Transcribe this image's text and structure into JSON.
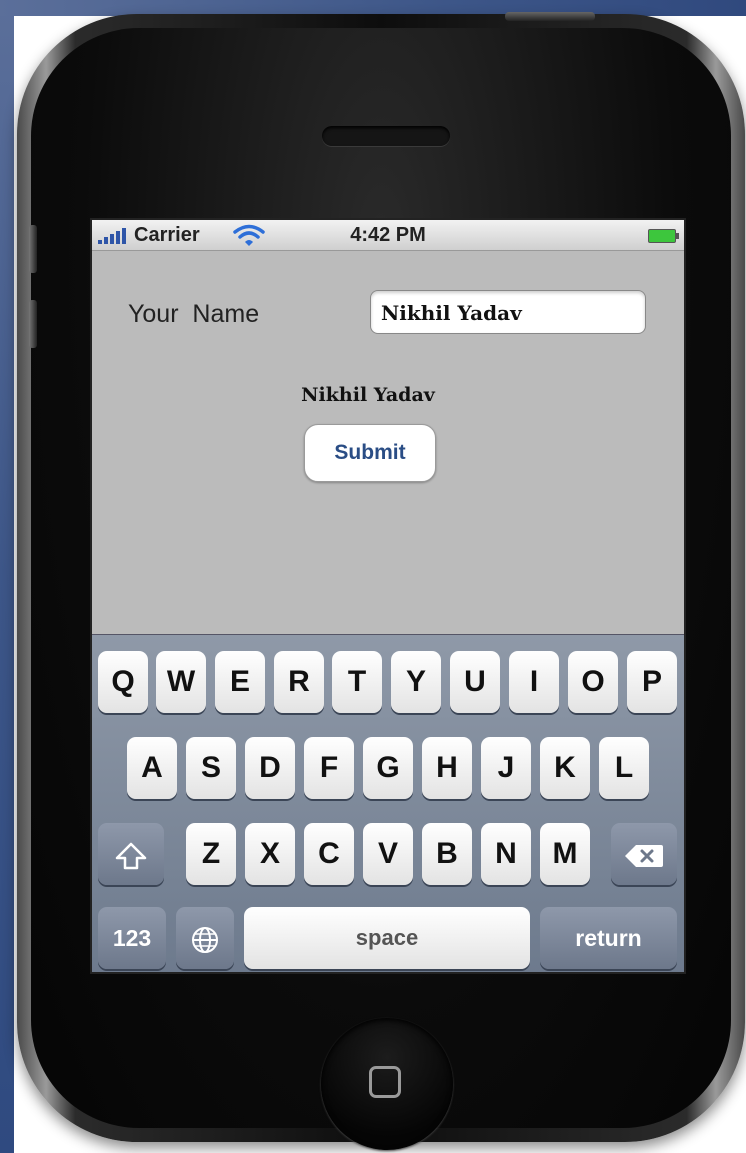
{
  "status_bar": {
    "carrier": "Carrier",
    "time": "4:42 PM",
    "icons": [
      "signal-bars-icon",
      "wifi-icon",
      "battery-icon"
    ]
  },
  "form": {
    "name_label": "Your  Name",
    "name_value": "Nikhil Yadav",
    "echo_label": "Nikhil Yadav",
    "submit_label": "Submit"
  },
  "keyboard": {
    "row1": [
      "Q",
      "W",
      "E",
      "R",
      "T",
      "Y",
      "U",
      "I",
      "O",
      "P"
    ],
    "row2": [
      "A",
      "S",
      "D",
      "F",
      "G",
      "H",
      "J",
      "K",
      "L"
    ],
    "row3": [
      "Z",
      "X",
      "C",
      "V",
      "B",
      "N",
      "M"
    ],
    "numbers_label": "123",
    "space_label": "space",
    "return_label": "return"
  },
  "colors": {
    "button_text": "#2a4d85",
    "screen_bg": "#bbbbbb",
    "battery": "#3dc63d"
  }
}
